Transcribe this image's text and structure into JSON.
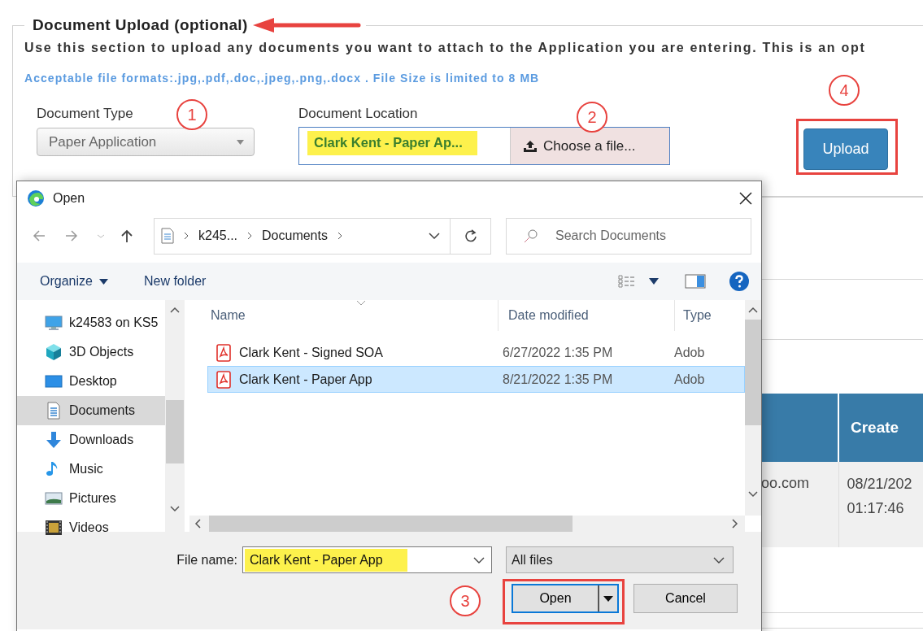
{
  "section": {
    "title": "Document Upload (optional)",
    "description": "Use this section to upload any documents you want to attach to the Application you are entering. This is an opt",
    "formats_note": "Acceptable file formats:.jpg,.pdf,.doc,.jpeg,.png,.docx . File Size is limited to 8 MB",
    "document_type": {
      "label": "Document Type",
      "value": "Paper Application"
    },
    "document_location": {
      "label": "Document Location",
      "value": "Clark Kent - Paper Ap...",
      "highlighted": true,
      "button": "Choose a file..."
    },
    "upload_button": "Upload"
  },
  "background_table": {
    "header": "Create",
    "cells": [
      "oo.com",
      "08/21/202",
      "01:17:46"
    ]
  },
  "dialog": {
    "title": "Open",
    "breadcrumbs": [
      "k245...",
      "Documents"
    ],
    "search": {
      "placeholder": "Search Documents"
    },
    "toolbar": {
      "organize": "Organize",
      "new_folder": "New folder"
    },
    "nav": [
      {
        "label": "k24583 on KS5",
        "kind": "computer",
        "selected": false
      },
      {
        "label": "3D Objects",
        "kind": "objects",
        "selected": false
      },
      {
        "label": "Desktop",
        "kind": "desktop",
        "selected": false
      },
      {
        "label": "Documents",
        "kind": "documents",
        "selected": true
      },
      {
        "label": "Downloads",
        "kind": "downloads",
        "selected": false
      },
      {
        "label": "Music",
        "kind": "music",
        "selected": false
      },
      {
        "label": "Pictures",
        "kind": "pictures",
        "selected": false
      },
      {
        "label": "Videos",
        "kind": "videos",
        "selected": false
      }
    ],
    "columns": [
      "Name",
      "Date modified",
      "Type"
    ],
    "files": [
      {
        "name": "Clark Kent - Signed SOA",
        "date": "6/27/2022 1:35 PM",
        "type": "Adob",
        "selected": false
      },
      {
        "name": "Clark Kent - Paper App",
        "date": "8/21/2022 1:35 PM",
        "type": "Adob",
        "selected": true
      }
    ],
    "file_name": {
      "label": "File name:",
      "value": "Clark Kent - Paper App",
      "highlighted": true
    },
    "file_type": "All files",
    "buttons": {
      "open": "Open",
      "cancel": "Cancel"
    }
  },
  "callouts": [
    {
      "text": "1"
    },
    {
      "text": "2"
    },
    {
      "text": "4"
    },
    {
      "text": "3"
    }
  ]
}
